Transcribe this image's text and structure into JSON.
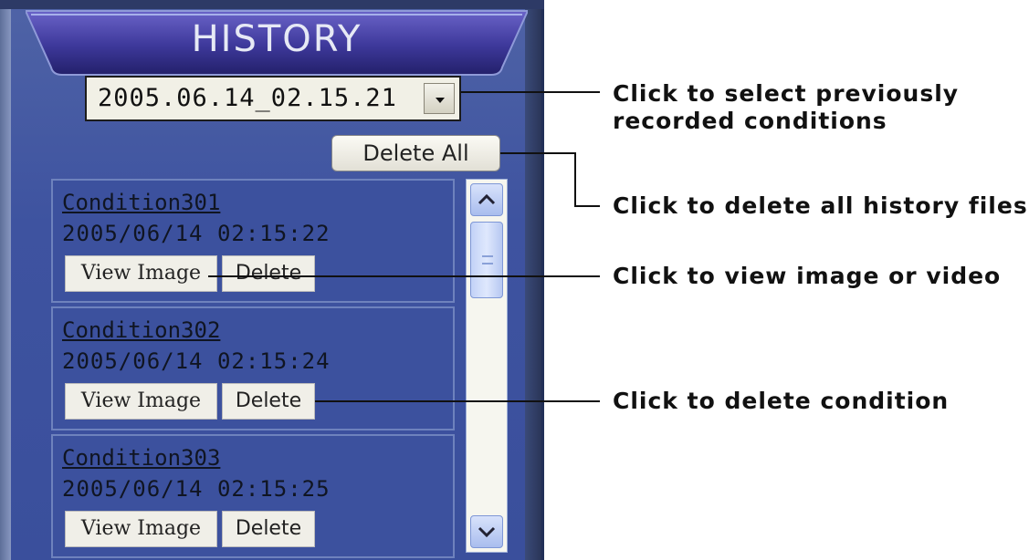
{
  "panel": {
    "title": "HISTORY",
    "dropdown": {
      "selected": "2005.06.14_02.15.21",
      "icon": "chevron-down-icon"
    },
    "delete_all_label": "Delete All",
    "items": [
      {
        "name": "Condition301",
        "timestamp": "2005/06/14 02:15:22",
        "view_label": "View Image",
        "delete_label": "Delete"
      },
      {
        "name": "Condition302",
        "timestamp": "2005/06/14 02:15:24",
        "view_label": "View Image",
        "delete_label": "Delete"
      },
      {
        "name": "Condition303",
        "timestamp": "2005/06/14 02:15:25",
        "view_label": "View Image",
        "delete_label": "Delete"
      }
    ],
    "scrollbar": {
      "up_icon": "chevron-up-icon",
      "down_icon": "chevron-down-icon"
    }
  },
  "annotations": {
    "select_line1": "Click to select previously",
    "select_line2": "recorded conditions",
    "delete_all": "Click to delete all history files",
    "view_image": "Click to view image or video",
    "delete_condition": "Click to delete condition"
  },
  "colors": {
    "panel_blue": "#3e53a0",
    "header_purple": "#3c3a8f",
    "button_face": "#f0efe8"
  }
}
